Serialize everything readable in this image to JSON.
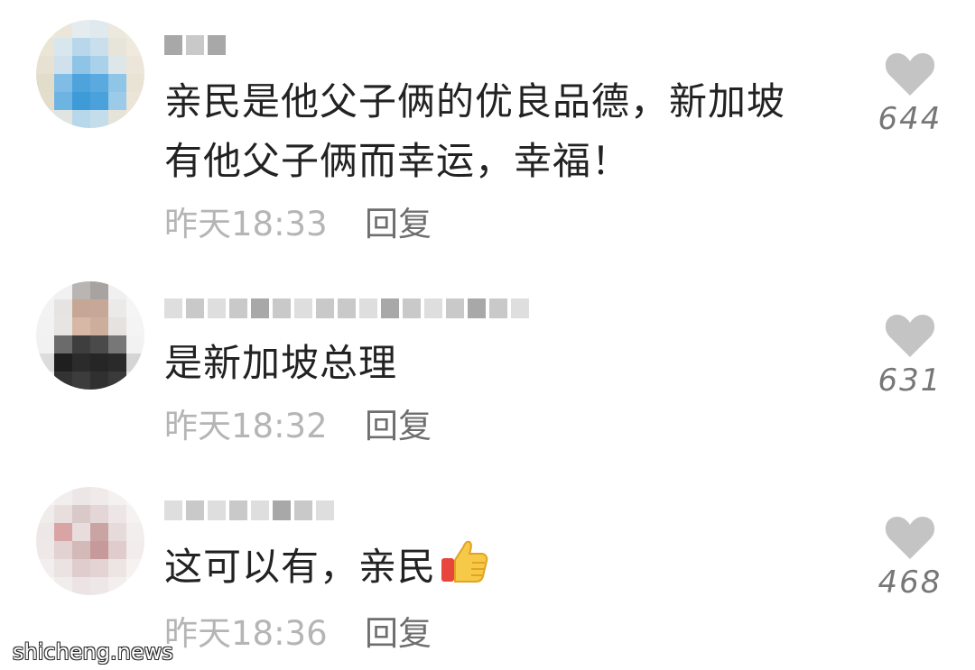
{
  "comments": [
    {
      "text_line1": "亲民是他父子俩的优良品德，新加坡",
      "text_line2": "有他父子俩而幸运，幸福！",
      "time": "昨天18:33",
      "reply_label": "回复",
      "likes": "644"
    },
    {
      "text_line1": "是新加坡总理",
      "time": "昨天18:32",
      "reply_label": "回复",
      "likes": "631"
    },
    {
      "text_line1": "这可以有，亲民",
      "emoji": "thumbs-up-icon",
      "time": "昨天18:36",
      "reply_label": "回复",
      "likes": "468"
    }
  ],
  "watermark": "shicheng.news",
  "colors": {
    "text": "#222222",
    "meta": "#b5b5b5",
    "reply": "#6e6e6e",
    "heart": "#c4c4c4"
  }
}
